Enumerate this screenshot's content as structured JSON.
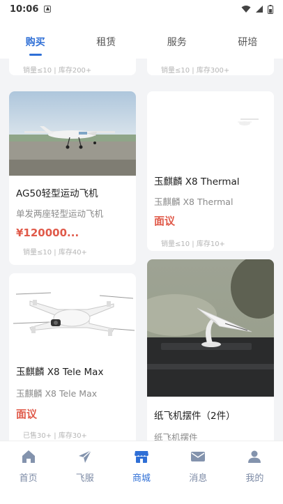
{
  "status_bar": {
    "time": "10:06",
    "sim_icon": "sim-card-icon",
    "wifi_icon": "wifi-icon",
    "signal_icon": "signal-icon",
    "battery_icon": "battery-icon"
  },
  "tabs": [
    {
      "label": "购买",
      "active": true
    },
    {
      "label": "租赁",
      "active": false
    },
    {
      "label": "服务",
      "active": false
    },
    {
      "label": "研培",
      "active": false
    }
  ],
  "partial_cards": [
    {
      "stats": "销量≤10 | 库存200+"
    },
    {
      "stats": "销量≤10 | 库存300+"
    }
  ],
  "products": [
    {
      "title": "AG50轻型运动飞机",
      "subtitle": "单发两座轻型运动飞机",
      "price": "¥120000...",
      "stats": "销量≤10 | 库存40+",
      "image": "light-sport-aircraft-photo"
    },
    {
      "title": "玉麒麟 X8 Thermal",
      "subtitle": "玉麒麟 X8 Thermal",
      "price": "面议",
      "stats": "销量≤10 | 库存10+",
      "image": "thermal-drone-photo"
    },
    {
      "title": "玉麒麟 X8 Tele Max",
      "subtitle": "玉麒麟 X8 Tele Max",
      "price": "面议",
      "stats": "已售30+ | 库存30+",
      "image": "white-drone-photo"
    },
    {
      "title": "纸飞机摆件（2件）",
      "subtitle": "纸飞机摆件",
      "image": "paper-plane-ornament-photo"
    }
  ],
  "bottom_nav": [
    {
      "label": "首页",
      "icon": "home-icon",
      "active": false
    },
    {
      "label": "飞服",
      "icon": "paper-plane-icon",
      "active": false
    },
    {
      "label": "商城",
      "icon": "store-icon",
      "active": true
    },
    {
      "label": "消息",
      "icon": "mail-icon",
      "active": false
    },
    {
      "label": "我的",
      "icon": "user-icon",
      "active": false
    }
  ],
  "colors": {
    "accent": "#2f6fd6",
    "price": "#e05a4a",
    "background": "#f3f4f6"
  }
}
